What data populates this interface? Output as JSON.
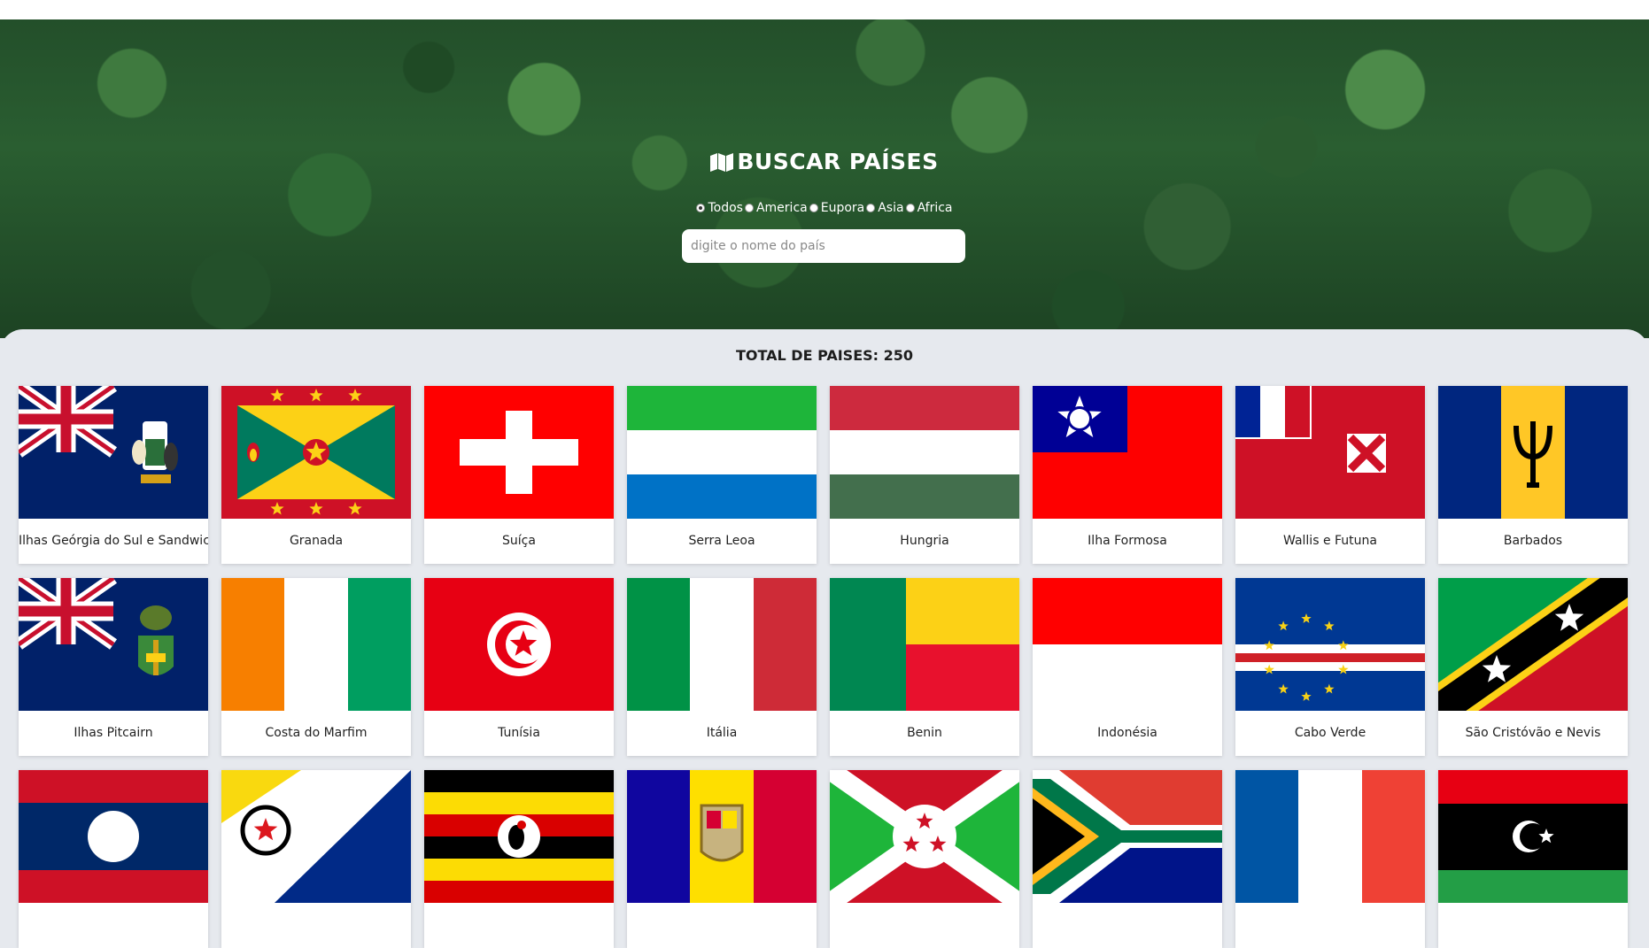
{
  "header": {
    "title": "BUSCAR PAÍSES",
    "icon": "map-icon",
    "filters": [
      {
        "label": "Todos",
        "checked": true
      },
      {
        "label": "America",
        "checked": false
      },
      {
        "label": "Eupora",
        "checked": false
      },
      {
        "label": "Asia",
        "checked": false
      },
      {
        "label": "Africa",
        "checked": false
      }
    ],
    "search_placeholder": "digite o nome do país",
    "search_value": ""
  },
  "total_label": "TOTAL DE PAISES: 250",
  "countries": [
    {
      "name": "Ilhas Geórgia do Sul e Sandwich",
      "flag": "sgs"
    },
    {
      "name": "Granada",
      "flag": "grd"
    },
    {
      "name": "Suíça",
      "flag": "che"
    },
    {
      "name": "Serra Leoa",
      "flag": "sle"
    },
    {
      "name": "Hungria",
      "flag": "hun"
    },
    {
      "name": "Ilha Formosa",
      "flag": "twn"
    },
    {
      "name": "Wallis e Futuna",
      "flag": "wlf"
    },
    {
      "name": "Barbados",
      "flag": "brb"
    },
    {
      "name": "Ilhas Pitcairn",
      "flag": "pcn"
    },
    {
      "name": "Costa do Marfim",
      "flag": "civ"
    },
    {
      "name": "Tunísia",
      "flag": "tun"
    },
    {
      "name": "Itália",
      "flag": "ita"
    },
    {
      "name": "Benin",
      "flag": "ben"
    },
    {
      "name": "Indonésia",
      "flag": "idn"
    },
    {
      "name": "Cabo Verde",
      "flag": "cpv"
    },
    {
      "name": "São Cristóvão e Nevis",
      "flag": "kna"
    },
    {
      "name": "",
      "flag": "lao"
    },
    {
      "name": "",
      "flag": "bes"
    },
    {
      "name": "",
      "flag": "uga"
    },
    {
      "name": "",
      "flag": "and"
    },
    {
      "name": "",
      "flag": "bdi"
    },
    {
      "name": "",
      "flag": "zaf"
    },
    {
      "name": "",
      "flag": "fra"
    },
    {
      "name": "",
      "flag": "lby"
    }
  ]
}
